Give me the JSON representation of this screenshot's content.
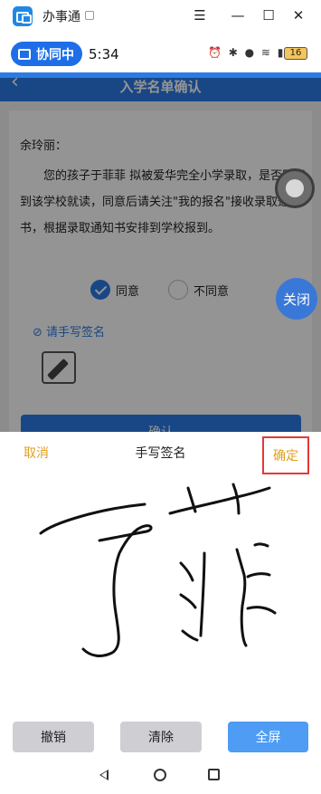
{
  "window": {
    "app_title": "办事通",
    "minimize_glyph": "—",
    "menu_glyph": "☰",
    "maximize_glyph": "☐",
    "close_glyph": "✕"
  },
  "status_bar": {
    "collab_label": "协同中",
    "time": "5:34",
    "icons": "⏰ ✱ ● ≋ ▮▮▮",
    "battery": "16"
  },
  "page": {
    "back_glyph": "‹",
    "title": "入学名单确认",
    "greeting": "余玲丽：",
    "body": "您的孩子于菲菲 拟被爱华完全小学录取，是否同意到该学校就读，同意后请关注\"我的报名\"接收录取通知书，根据录取通知书安排到学校报到。",
    "agree_label": "同意",
    "disagree_label": "不同意",
    "signature_link": "请手写签名",
    "confirm_button": "确认",
    "close_fab": "关闭"
  },
  "signature_sheet": {
    "cancel_label": "取消",
    "title": "手写签名",
    "ok_label": "确定",
    "undo_label": "撤销",
    "clear_label": "清除",
    "fullscreen_label": "全屏"
  },
  "colors": {
    "accent_blue": "#2c7be5",
    "cancel_orange": "#e0a020",
    "highlight_red": "#e53935"
  }
}
